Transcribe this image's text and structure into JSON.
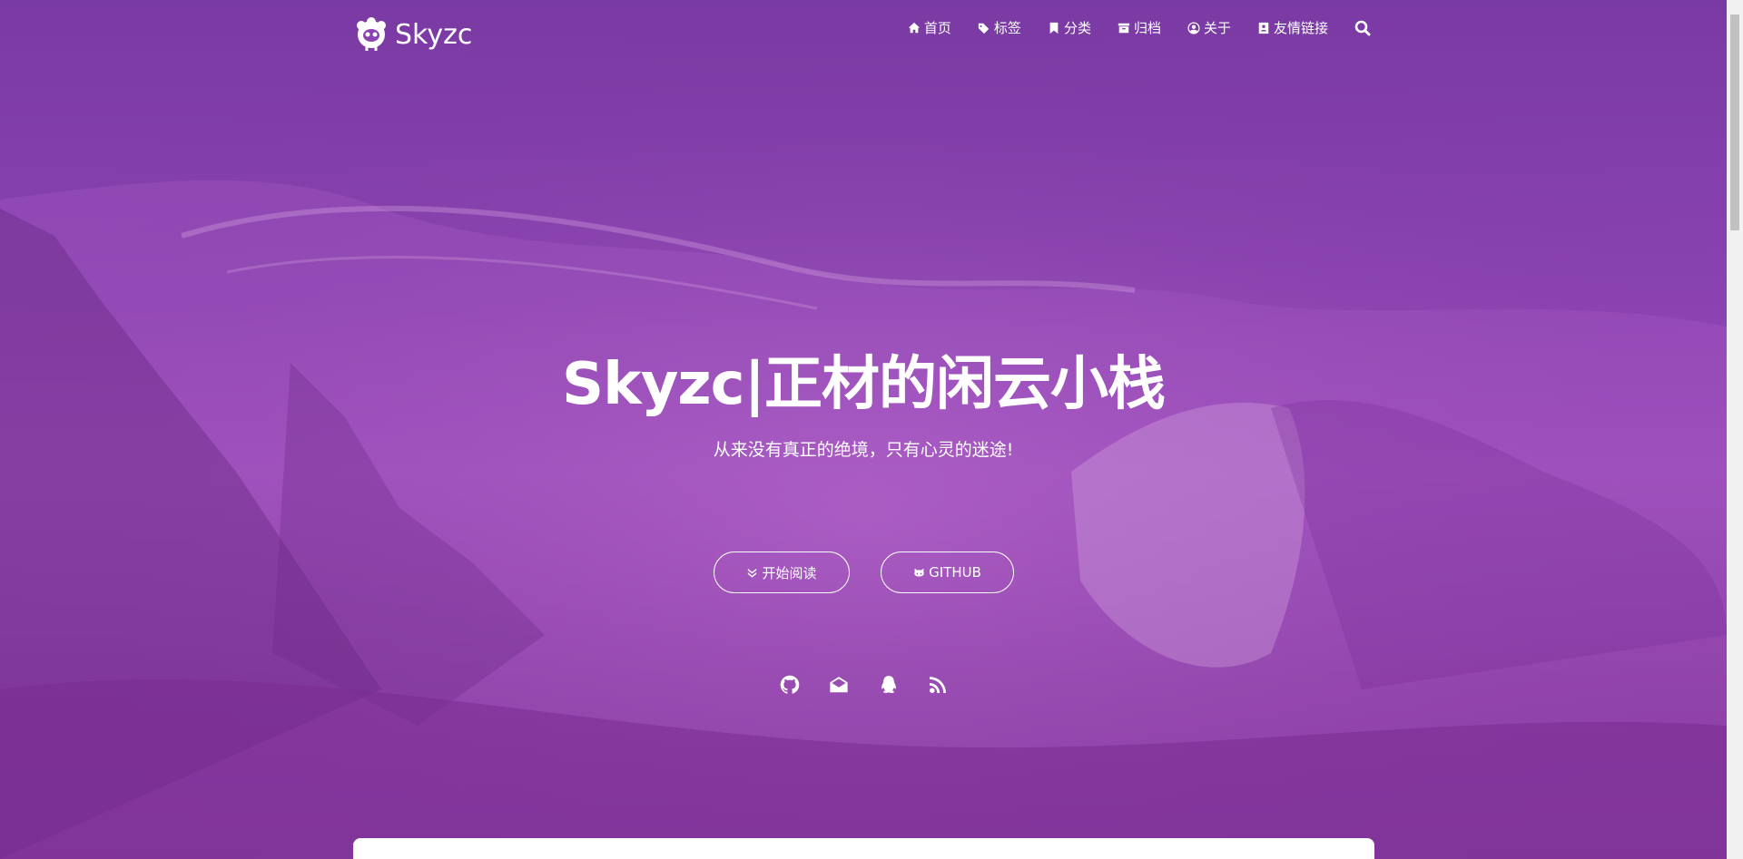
{
  "brand": {
    "name": "Skyzc",
    "logo_icon": "sheep-logo-icon"
  },
  "nav": {
    "items": [
      {
        "label": "首页",
        "icon": "home-icon"
      },
      {
        "label": "标签",
        "icon": "tags-icon"
      },
      {
        "label": "分类",
        "icon": "bookmark-icon"
      },
      {
        "label": "归档",
        "icon": "archive-icon"
      },
      {
        "label": "关于",
        "icon": "user-circle-icon"
      },
      {
        "label": "友情链接",
        "icon": "address-book-icon"
      }
    ],
    "search_icon": "search-icon"
  },
  "hero": {
    "title": "Skyzc|正材的闲云小栈",
    "subtitle": "从来没有真正的绝境，只有心灵的迷途!",
    "buttons": {
      "read_label": "开始阅读",
      "read_icon": "angle-double-down-icon",
      "github_label": "GITHUB",
      "github_icon": "github-cat-icon"
    },
    "social": [
      "github-icon",
      "envelope-icon",
      "qq-icon",
      "rss-icon"
    ]
  },
  "colors": {
    "background": "#8a43b1",
    "text": "#ffffff"
  }
}
